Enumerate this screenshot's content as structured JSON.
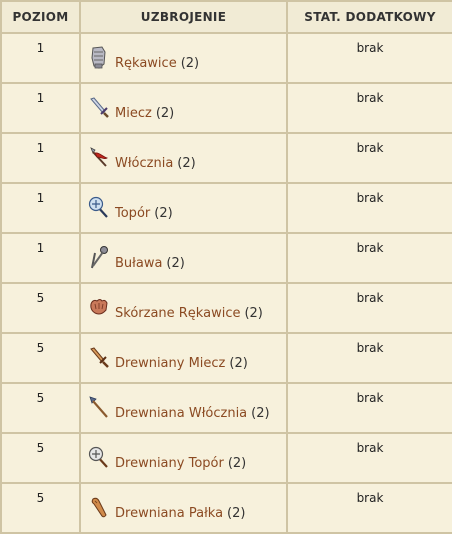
{
  "headers": {
    "level": "POZIOM",
    "weapon": "UZBROJENIE",
    "bonus": "STAT. DODATKOWY"
  },
  "rows": [
    {
      "level": "1",
      "name": "Rękawice",
      "count": "(2)",
      "bonus": "brak",
      "icon": "gauntlet-icon"
    },
    {
      "level": "1",
      "name": "Miecz",
      "count": "(2)",
      "bonus": "brak",
      "icon": "sword-icon"
    },
    {
      "level": "1",
      "name": "Włócznia",
      "count": "(2)",
      "bonus": "brak",
      "icon": "spear-icon"
    },
    {
      "level": "1",
      "name": "Topór",
      "count": "(2)",
      "bonus": "brak",
      "icon": "axe-icon"
    },
    {
      "level": "1",
      "name": "Buława",
      "count": "(2)",
      "bonus": "brak",
      "icon": "mace-icon"
    },
    {
      "level": "5",
      "name": "Skórzane Rękawice",
      "count": "(2)",
      "bonus": "brak",
      "icon": "leather-gloves-icon"
    },
    {
      "level": "5",
      "name": "Drewniany Miecz",
      "count": "(2)",
      "bonus": "brak",
      "icon": "wooden-sword-icon"
    },
    {
      "level": "5",
      "name": "Drewniana Włócznia",
      "count": "(2)",
      "bonus": "brak",
      "icon": "wooden-spear-icon"
    },
    {
      "level": "5",
      "name": "Drewniany Topór",
      "count": "(2)",
      "bonus": "brak",
      "icon": "wooden-axe-icon"
    },
    {
      "level": "5",
      "name": "Drewniana Pałka",
      "count": "(2)",
      "bonus": "brak",
      "icon": "wooden-club-icon"
    }
  ]
}
